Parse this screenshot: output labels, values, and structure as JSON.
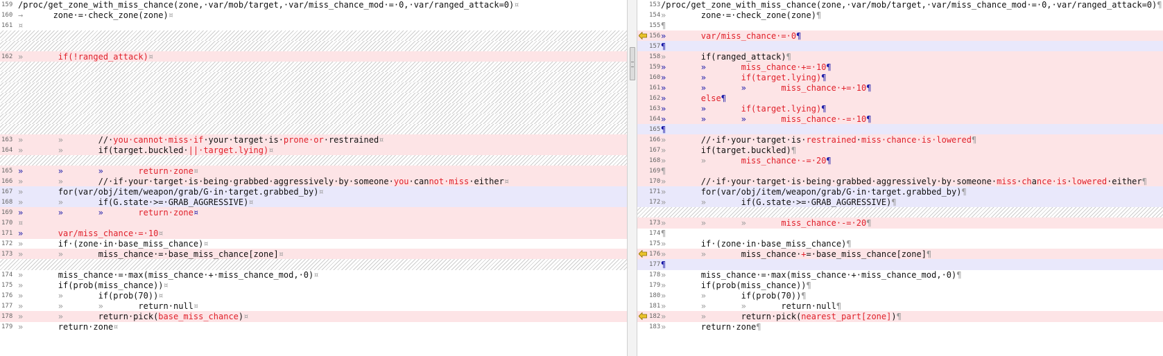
{
  "window": {
    "colors": {
      "changed_bg": "#fde4e6",
      "modified_bg": "#e9e8fb",
      "changed_text": "#e0202a",
      "line_number": "#666666",
      "hatch": "#cdcdcd",
      "conflict_arrow": "#e9c32a"
    },
    "splitter": {
      "grip_icon": "scrollbar-grip"
    }
  },
  "panes": {
    "left": [
      {
        "t": "n",
        "n": "159",
        "s": [
          [
            "/proc/get_zone_with_miss_chance(zone,·var/mob/target,·var/miss_chance_mod·=·0,·var/ranged_attack=0)",
            ""
          ],
          [
            "¤",
            "m"
          ]
        ]
      },
      {
        "t": "n",
        "n": "160",
        "s": [
          [
            "→      ",
            "m"
          ],
          [
            "zone·=·check_zone(zone)",
            ""
          ],
          [
            "¤",
            "m"
          ]
        ]
      },
      {
        "t": "n",
        "n": "161",
        "s": [
          [
            "¤",
            "m"
          ]
        ]
      },
      {
        "t": "h"
      },
      {
        "t": "h"
      },
      {
        "t": "p",
        "n": "162",
        "s": [
          [
            "»       ",
            "m"
          ],
          [
            "if(!ranged_attack)",
            ""
          ],
          [
            "¤",
            "m"
          ]
        ]
      },
      {
        "t": "h"
      },
      {
        "t": "h"
      },
      {
        "t": "h"
      },
      {
        "t": "h"
      },
      {
        "t": "h"
      },
      {
        "t": "h"
      },
      {
        "t": "h"
      },
      {
        "t": "p",
        "n": "163",
        "s": [
          [
            "»       »       ",
            "m"
          ],
          [
            "//·",
            ""
          ],
          [
            "you·cannot·miss·if",
            ""
          ],
          [
            "·your·target·is·",
            ""
          ],
          [
            "prone·or",
            ""
          ],
          [
            "·restrained",
            ""
          ],
          [
            "¤",
            "m"
          ]
        ]
      },
      {
        "t": "p",
        "n": "164",
        "s": [
          [
            "»       »       ",
            "m"
          ],
          [
            "if(target.buckled·",
            ""
          ],
          [
            "||·target.lying)",
            ""
          ],
          [
            "¤",
            "m"
          ]
        ]
      },
      {
        "t": "h"
      },
      {
        "t": "p",
        "n": "165",
        "s": [
          [
            "»       »       »       ",
            "b"
          ],
          [
            "return·zone",
            ""
          ],
          [
            "¤",
            "m"
          ]
        ]
      },
      {
        "t": "p",
        "n": "166",
        "s": [
          [
            "»       »       ",
            "m"
          ],
          [
            "//·if·your·target·is·being·grabbed·aggressively·by·someone·",
            ""
          ],
          [
            "you",
            ""
          ],
          [
            "·can",
            ""
          ],
          [
            "not·miss",
            ""
          ],
          [
            "·either",
            ""
          ],
          [
            "¤",
            "m"
          ]
        ]
      },
      {
        "t": "l",
        "n": "167",
        "s": [
          [
            "»       ",
            "m"
          ],
          [
            "for(var/obj/item/weapon/grab/G·in·target.grabbed_by)",
            ""
          ],
          [
            "¤",
            "m"
          ]
        ]
      },
      {
        "t": "l",
        "n": "168",
        "s": [
          [
            "»       »       ",
            "m"
          ],
          [
            "if(G.state·>=·GRAB_AGGRESSIVE)",
            ""
          ],
          [
            "¤",
            "m"
          ]
        ]
      },
      {
        "t": "p",
        "n": "169",
        "s": [
          [
            "»       »       »       ",
            "b"
          ],
          [
            "return·zone",
            ""
          ],
          [
            "¤",
            "b"
          ]
        ]
      },
      {
        "t": "p",
        "n": "170",
        "s": [
          [
            "¤",
            "m"
          ]
        ]
      },
      {
        "t": "p",
        "n": "171",
        "s": [
          [
            "»       ",
            "b"
          ],
          [
            "var/miss_chance·=·10",
            ""
          ],
          [
            "¤",
            "m"
          ]
        ]
      },
      {
        "t": "n",
        "n": "172",
        "s": [
          [
            "»       ",
            "m"
          ],
          [
            "if·(zone·in·base_miss_chance)",
            ""
          ],
          [
            "¤",
            "m"
          ]
        ]
      },
      {
        "t": "p",
        "n": "173",
        "s": [
          [
            "»       »       ",
            "m"
          ],
          [
            "miss_chance·=·base_miss_chance[zone]",
            ""
          ],
          [
            "¤",
            "m"
          ]
        ]
      },
      {
        "t": "h"
      },
      {
        "t": "n",
        "n": "174",
        "s": [
          [
            "»       ",
            "m"
          ],
          [
            "miss_chance·=·max(miss_chance·+·miss_chance_mod,·0)",
            ""
          ],
          [
            "¤",
            "m"
          ]
        ]
      },
      {
        "t": "n",
        "n": "175",
        "s": [
          [
            "»       ",
            "m"
          ],
          [
            "if(prob(miss_chance))",
            ""
          ],
          [
            "¤",
            "m"
          ]
        ]
      },
      {
        "t": "n",
        "n": "176",
        "s": [
          [
            "»       »       ",
            "m"
          ],
          [
            "if(prob(70))",
            ""
          ],
          [
            "¤",
            "m"
          ]
        ]
      },
      {
        "t": "n",
        "n": "177",
        "s": [
          [
            "»       »       »       ",
            "m"
          ],
          [
            "return·null",
            ""
          ],
          [
            "¤",
            "m"
          ]
        ]
      },
      {
        "t": "p",
        "n": "178",
        "s": [
          [
            "»       »       ",
            "m"
          ],
          [
            "return·pick(",
            ""
          ],
          [
            "base_miss_chance",
            ""
          ],
          [
            ")",
            ""
          ],
          [
            "¤",
            "m"
          ]
        ]
      },
      {
        "t": "n",
        "n": "179",
        "s": [
          [
            "»       ",
            "m"
          ],
          [
            "return·zone",
            ""
          ],
          [
            "¤",
            "m"
          ]
        ]
      }
    ],
    "right": [
      {
        "t": "n",
        "n": "153",
        "s": [
          [
            "/proc/get_zone_with_miss_chance(zone,·var/mob/target,·var/miss_chance_mod·=·0,·var/ranged_attack=0)",
            ""
          ],
          [
            "¶",
            "m"
          ]
        ]
      },
      {
        "t": "n",
        "n": "154",
        "s": [
          [
            "»       ",
            "m"
          ],
          [
            "zone·=·check_zone(zone)",
            ""
          ],
          [
            "¶",
            "m"
          ]
        ]
      },
      {
        "t": "n",
        "n": "155",
        "s": [
          [
            "¶",
            "m"
          ]
        ]
      },
      {
        "t": "p",
        "n": "156",
        "a": true,
        "s": [
          [
            "»       ",
            "b"
          ],
          [
            "var/miss_chance·=·0",
            ""
          ],
          [
            "¶",
            "b"
          ]
        ]
      },
      {
        "t": "l",
        "n": "157",
        "s": [
          [
            "¶",
            "b"
          ]
        ]
      },
      {
        "t": "p",
        "n": "158",
        "s": [
          [
            "»       ",
            "m"
          ],
          [
            "if(ranged_attack)",
            ""
          ],
          [
            "¶",
            "m"
          ]
        ]
      },
      {
        "t": "p",
        "n": "159",
        "s": [
          [
            "»       »       ",
            "b"
          ],
          [
            "miss_chance·+=·10",
            ""
          ],
          [
            "¶",
            "b"
          ]
        ]
      },
      {
        "t": "p",
        "n": "160",
        "s": [
          [
            "»       »       ",
            "b"
          ],
          [
            "if(target.lying)",
            ""
          ],
          [
            "¶",
            "b"
          ]
        ]
      },
      {
        "t": "p",
        "n": "161",
        "s": [
          [
            "»       »       »       ",
            "b"
          ],
          [
            "miss_chance·+=·10",
            ""
          ],
          [
            "¶",
            "b"
          ]
        ]
      },
      {
        "t": "p",
        "n": "162",
        "s": [
          [
            "»       ",
            "b"
          ],
          [
            "else",
            ""
          ],
          [
            "¶",
            "b"
          ]
        ]
      },
      {
        "t": "p",
        "n": "163",
        "s": [
          [
            "»       »       ",
            "b"
          ],
          [
            "if(target.lying)",
            ""
          ],
          [
            "¶",
            "b"
          ]
        ]
      },
      {
        "t": "p",
        "n": "164",
        "s": [
          [
            "»       »       »       ",
            "b"
          ],
          [
            "miss_chance·-=·10",
            ""
          ],
          [
            "¶",
            "b"
          ]
        ]
      },
      {
        "t": "l",
        "n": "165",
        "s": [
          [
            "¶",
            "b"
          ]
        ]
      },
      {
        "t": "p",
        "n": "166",
        "s": [
          [
            "»       ",
            "m"
          ],
          [
            "//·if·your·target·is·",
            ""
          ],
          [
            "restrained",
            ""
          ],
          [
            "·",
            ""
          ],
          [
            "miss·chance·is·lowered",
            ""
          ],
          [
            "¶",
            "m"
          ]
        ]
      },
      {
        "t": "p",
        "n": "167",
        "s": [
          [
            "»       ",
            "m"
          ],
          [
            "if(target.buckled)",
            ""
          ],
          [
            "¶",
            "m"
          ]
        ]
      },
      {
        "t": "p",
        "n": "168",
        "s": [
          [
            "»       »       ",
            "m"
          ],
          [
            "miss_chance·-=·20",
            ""
          ],
          [
            "¶",
            "b"
          ]
        ]
      },
      {
        "t": "p",
        "n": "169",
        "s": [
          [
            "¶",
            "m"
          ]
        ]
      },
      {
        "t": "p",
        "n": "170",
        "s": [
          [
            "»       ",
            "m"
          ],
          [
            "//·if·your·target·is·being·grabbed·aggressively·by·someone·",
            ""
          ],
          [
            "miss",
            ""
          ],
          [
            "·",
            ""
          ],
          [
            "ch",
            ""
          ],
          [
            "a",
            ""
          ],
          [
            "nce·is",
            ""
          ],
          [
            "·",
            ""
          ],
          [
            "lowered",
            ""
          ],
          [
            "·either",
            ""
          ],
          [
            "¶",
            "m"
          ]
        ]
      },
      {
        "t": "l",
        "n": "171",
        "s": [
          [
            "»       ",
            "m"
          ],
          [
            "for(var/obj/item/weapon/grab/G·in·target.grabbed_by)",
            ""
          ],
          [
            "¶",
            "m"
          ]
        ]
      },
      {
        "t": "l",
        "n": "172",
        "s": [
          [
            "»       »       ",
            "m"
          ],
          [
            "if(G.state·>=·GRAB_AGGRESSIVE)",
            ""
          ],
          [
            "¶",
            "m"
          ]
        ]
      },
      {
        "t": "h"
      },
      {
        "t": "p",
        "n": "173",
        "s": [
          [
            "»       »       »       ",
            "m"
          ],
          [
            "miss_chance·-=·20",
            ""
          ],
          [
            "¶",
            "m"
          ]
        ]
      },
      {
        "t": "n",
        "n": "174",
        "s": [
          [
            "¶",
            "m"
          ]
        ]
      },
      {
        "t": "n",
        "n": "175",
        "s": [
          [
            "»       ",
            "m"
          ],
          [
            "if·(zone·in·base_miss_chance)",
            ""
          ],
          [
            "¶",
            "m"
          ]
        ]
      },
      {
        "t": "p",
        "n": "176",
        "a": true,
        "s": [
          [
            "»       »       ",
            "m"
          ],
          [
            "miss_chance·",
            ""
          ],
          [
            "+",
            ""
          ],
          [
            "=·base_miss_chance[zone]",
            ""
          ],
          [
            "¶",
            "m"
          ]
        ]
      },
      {
        "t": "l",
        "n": "177",
        "s": [
          [
            "¶",
            "b"
          ]
        ]
      },
      {
        "t": "n",
        "n": "178",
        "s": [
          [
            "»       ",
            "m"
          ],
          [
            "miss_chance·=·max(miss_chance·+·miss_chance_mod,·0)",
            ""
          ],
          [
            "¶",
            "m"
          ]
        ]
      },
      {
        "t": "n",
        "n": "179",
        "s": [
          [
            "»       ",
            "m"
          ],
          [
            "if(prob(miss_chance))",
            ""
          ],
          [
            "¶",
            "m"
          ]
        ]
      },
      {
        "t": "n",
        "n": "180",
        "s": [
          [
            "»       »       ",
            "m"
          ],
          [
            "if(prob(70))",
            ""
          ],
          [
            "¶",
            "m"
          ]
        ]
      },
      {
        "t": "n",
        "n": "181",
        "s": [
          [
            "»       »       »       ",
            "m"
          ],
          [
            "return·null",
            ""
          ],
          [
            "¶",
            "m"
          ]
        ]
      },
      {
        "t": "p",
        "n": "182",
        "a": true,
        "s": [
          [
            "»       »       ",
            "m"
          ],
          [
            "return·pick(",
            ""
          ],
          [
            "nearest_part[zone]",
            ""
          ],
          [
            ")",
            ""
          ],
          [
            "¶",
            "m"
          ]
        ]
      },
      {
        "t": "n",
        "n": "183",
        "s": [
          [
            "»       ",
            "m"
          ],
          [
            "return·zone",
            ""
          ],
          [
            "¶",
            "m"
          ]
        ]
      }
    ]
  }
}
